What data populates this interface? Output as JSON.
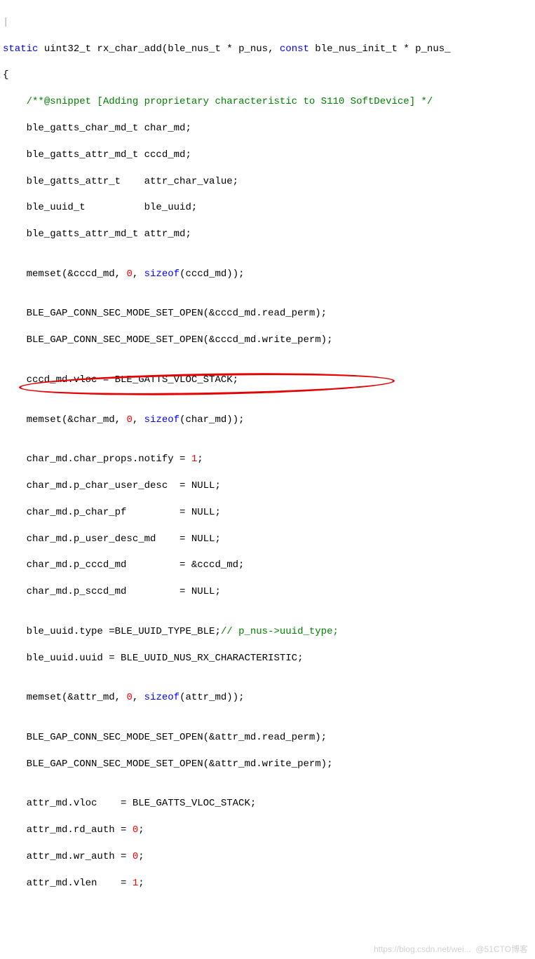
{
  "code": {
    "l00a": "|",
    "l00_static": "static",
    "l00_uint": " uint32_t rx_char_add(ble_nus_t * p_nus, ",
    "l00_const": "const",
    "l00_rest": " ble_nus_init_t * p_nus_",
    "l01": "{",
    "l02_lead": "    ",
    "l02_cmt": "/**@snippet [Adding proprietary characteristic to S110 SoftDevice] */",
    "l03": "    ble_gatts_char_md_t char_md;",
    "l04": "    ble_gatts_attr_md_t cccd_md;",
    "l05": "    ble_gatts_attr_t    attr_char_value;",
    "l06": "    ble_uuid_t          ble_uuid;",
    "l07": "    ble_gatts_attr_md_t attr_md;",
    "l08": "",
    "l09a": "    memset(&cccd_md, ",
    "l09n": "0",
    "l09b": ", ",
    "l09s": "sizeof",
    "l09c": "(cccd_md));",
    "l10": "",
    "l11": "    BLE_GAP_CONN_SEC_MODE_SET_OPEN(&cccd_md.read_perm);",
    "l12": "    BLE_GAP_CONN_SEC_MODE_SET_OPEN(&cccd_md.write_perm);",
    "l13": "",
    "l14": "    cccd_md.vloc = BLE_GATTS_VLOC_STACK;",
    "l15": "",
    "l16a": "    memset(&char_md, ",
    "l16n": "0",
    "l16b": ", ",
    "l16s": "sizeof",
    "l16c": "(char_md));",
    "l17": "",
    "l18a": "    char_md.char_props.notify = ",
    "l18n": "1",
    "l18b": ";",
    "l19": "    char_md.p_char_user_desc  = NULL;",
    "l20": "    char_md.p_char_pf         = NULL;",
    "l21": "    char_md.p_user_desc_md    = NULL;",
    "l22": "    char_md.p_cccd_md         = &cccd_md;",
    "l23": "    char_md.p_sccd_md         = NULL;",
    "l24": "",
    "l25a": "    ble_uuid.type =BLE_UUID_TYPE_BLE;",
    "l25c": "// p_nus->uuid_type;",
    "l26": "    ble_uuid.uuid = BLE_UUID_NUS_RX_CHARACTERISTIC;",
    "l27": "",
    "l28a": "    memset(&attr_md, ",
    "l28n": "0",
    "l28b": ", ",
    "l28s": "sizeof",
    "l28c": "(attr_md));",
    "l29": "",
    "l30": "    BLE_GAP_CONN_SEC_MODE_SET_OPEN(&attr_md.read_perm);",
    "l31": "    BLE_GAP_CONN_SEC_MODE_SET_OPEN(&attr_md.write_perm);",
    "l32": "",
    "l33": "    attr_md.vloc    = BLE_GATTS_VLOC_STACK;",
    "l34a": "    attr_md.rd_auth = ",
    "l34n": "0",
    "l34b": ";",
    "l35a": "    attr_md.wr_auth = ",
    "l35n": "0",
    "l35b": ";",
    "l36a": "    attr_md.vlen    = ",
    "l36n": "1",
    "l36b": ";"
  },
  "watermark": "https://blog.csdn.net/wei...  @51CTO博客"
}
